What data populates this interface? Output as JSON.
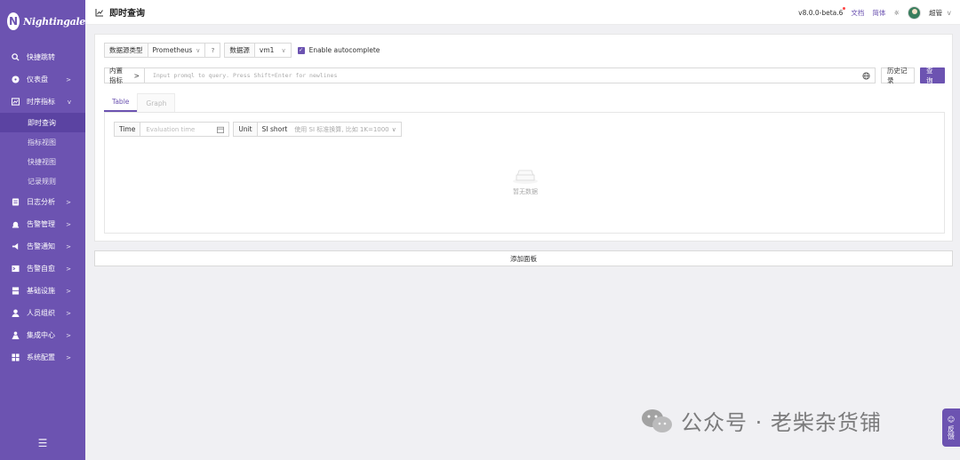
{
  "sidebar": {
    "logo_text": "Nightingale",
    "items": [
      {
        "label": "快捷跳转",
        "icon": "search-icon",
        "arrow": ""
      },
      {
        "label": "仪表盘",
        "icon": "dashboard-icon",
        "arrow": ">"
      },
      {
        "label": "时序指标",
        "icon": "metrics-icon",
        "arrow": "v"
      },
      {
        "label": "日志分析",
        "icon": "log-icon",
        "arrow": ">"
      },
      {
        "label": "告警管理",
        "icon": "alarm-icon",
        "arrow": ">"
      },
      {
        "label": "告警通知",
        "icon": "notify-icon",
        "arrow": ">"
      },
      {
        "label": "告警自愈",
        "icon": "terminal-icon",
        "arrow": ">"
      },
      {
        "label": "基础设施",
        "icon": "server-icon",
        "arrow": ">"
      },
      {
        "label": "人员组织",
        "icon": "user-icon",
        "arrow": ">"
      },
      {
        "label": "集成中心",
        "icon": "integration-icon",
        "arrow": ">"
      },
      {
        "label": "系统配置",
        "icon": "apps-icon",
        "arrow": ">"
      }
    ],
    "sub_items": [
      "即时查询",
      "指标视图",
      "快捷视图",
      "记录规则"
    ],
    "collapse_icon": "menu-fold-icon"
  },
  "header": {
    "title": "即时查询",
    "version": "v8.0.0-beta.6",
    "docs": "文档",
    "lang": "简体",
    "user": "超管",
    "user_chevron": "v"
  },
  "query": {
    "ds_type_label": "数据源类型",
    "ds_type_value": "Prometheus",
    "ds_label": "数据源",
    "ds_value": "vm1",
    "autocomplete_label": "Enable autocomplete",
    "builtin_label": "内置指标",
    "builtin_chevron": ">",
    "promql_placeholder": "Input promql to query. Press Shift+Enter for newlines",
    "history_label": "历史记录",
    "query_label": "查 询"
  },
  "tabs": [
    "Table",
    "Graph"
  ],
  "table_tab": {
    "time_label": "Time",
    "time_placeholder": "Evaluation time",
    "unit_label": "Unit",
    "unit_value": "SI short",
    "unit_hint": "使用 SI 标准换算, 比如 1K=1000",
    "empty_text": "暂无数据"
  },
  "add_panel_label": "添加面板",
  "watermark": "公众号 · 老柴杂货铺",
  "feedback_label": "反馈",
  "colors": {
    "brand": "#6c53b1",
    "sidebar_active": "#5b43a2"
  }
}
